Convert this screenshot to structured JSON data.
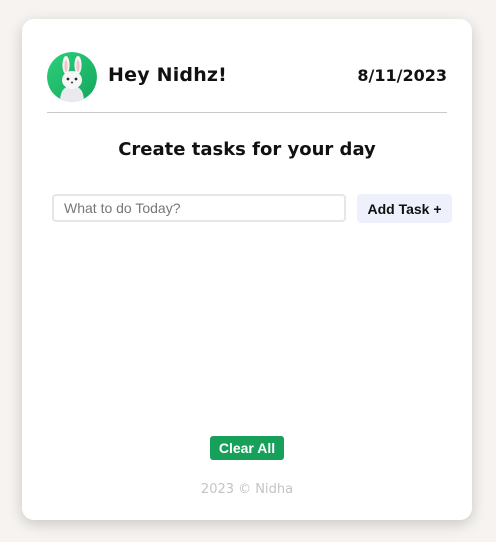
{
  "header": {
    "greeting": "Hey Nidhz!",
    "date": "8/11/2023",
    "avatar_icon": "white-rabbit-avatar-icon"
  },
  "main": {
    "title": "Create tasks for your day",
    "input_placeholder": "What to do Today?",
    "input_value": "",
    "add_button_label": "Add Task +",
    "tasks": [],
    "clear_button_label": "Clear All"
  },
  "footer": {
    "text": "2023 © Nidha"
  },
  "colors": {
    "page_bg": "#f6f3f0",
    "card_bg": "#ffffff",
    "avatar_bg": "#22b36b",
    "add_button_bg": "#eef0fb",
    "clear_button_bg": "#16a05a",
    "footer_text": "#c4c4c4"
  }
}
